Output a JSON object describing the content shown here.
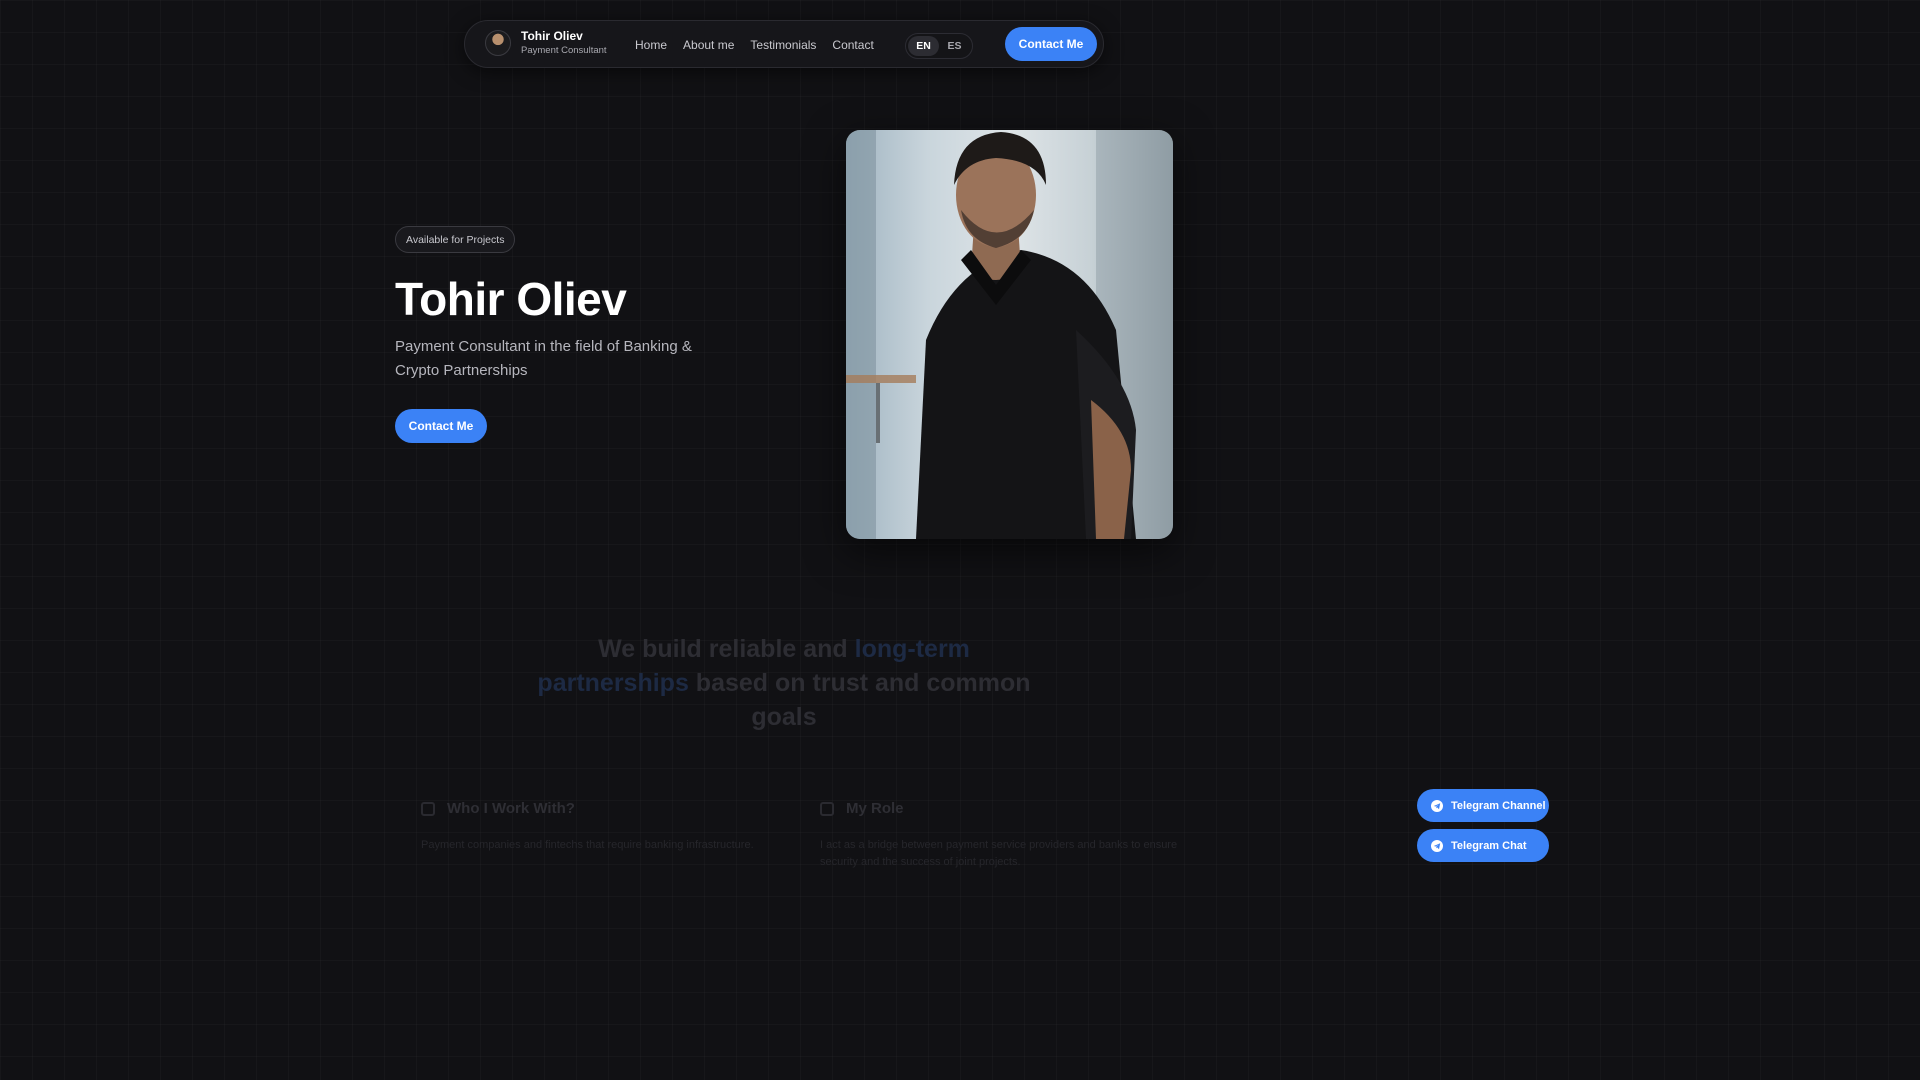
{
  "nav": {
    "brand_name": "Tohir Oliev",
    "brand_role": "Payment Consultant",
    "links": [
      {
        "label": "Home"
      },
      {
        "label": "About me"
      },
      {
        "label": "Testimonials"
      },
      {
        "label": "Contact"
      }
    ],
    "languages": [
      {
        "label": "EN",
        "active": true
      },
      {
        "label": "ES",
        "active": false
      }
    ],
    "cta_label": "Contact Me"
  },
  "hero": {
    "badge": "Available for Projects",
    "title": "Tohir Oliev",
    "subtitle": "Payment Consultant in the field of Banking & Crypto Partnerships",
    "cta_label": "Contact Me"
  },
  "mission": {
    "part1": "We build reliable and ",
    "highlight": "long-term partnerships",
    "part2": " based on trust and common goals"
  },
  "cards": [
    {
      "title": "Who I Work With?",
      "text": "Payment companies and fintechs that require banking infrastructure."
    },
    {
      "title": "My Role",
      "text": "I act as a bridge between payment service providers and banks to ensure security and the success of joint projects."
    }
  ],
  "floating": {
    "telegram_channel": "Telegram Channel",
    "telegram_chat": "Telegram Chat"
  },
  "colors": {
    "accent": "#3b82f6",
    "background": "#111114"
  }
}
